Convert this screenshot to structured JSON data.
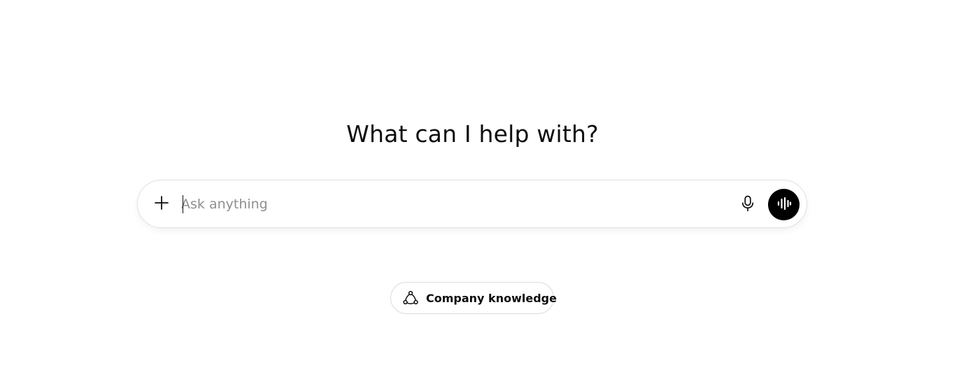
{
  "main": {
    "heading": "What can I help with?"
  },
  "composer": {
    "placeholder": "Ask anything",
    "value": "",
    "plus_icon": "plus-icon",
    "mic_icon": "microphone-icon",
    "voice_icon": "voice-waveform-icon"
  },
  "suggestions": {
    "chips": [
      {
        "label": "Company knowledge",
        "icon": "company-knowledge-icon"
      }
    ]
  },
  "colors": {
    "text": "#0d0d0d",
    "placeholder": "#8f8f8f",
    "voice_button": "#000000",
    "border": "#e3e3e3"
  }
}
